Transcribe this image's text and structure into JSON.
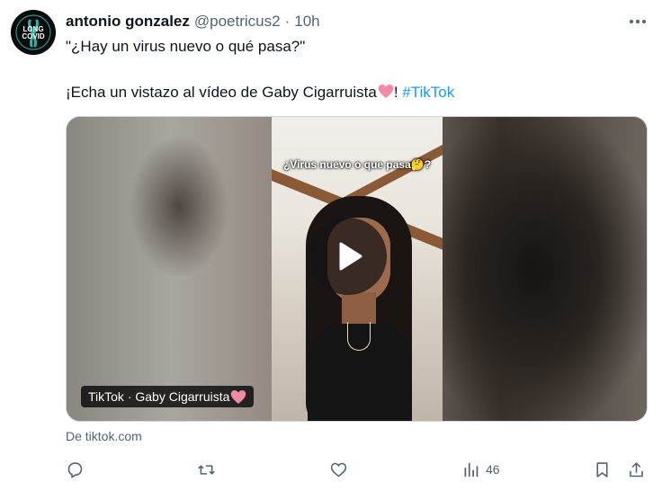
{
  "author": {
    "avatar_text_top": "LONG",
    "avatar_text_bottom": "COVID",
    "display_name": "antonio gonzalez",
    "handle": "@poetricus2",
    "separator": "·",
    "time": "10h"
  },
  "tweet": {
    "line1": "\"¿Hay un virus nuevo o qué pasa?\"",
    "line2_text": "¡Echa un vistazo al vídeo de Gaby Cigarruista",
    "line2_after_emoji": "! ",
    "hashtag": "#TikTok"
  },
  "card": {
    "video_caption": "¿Virus nuevo o que pasa🤔?",
    "source_label": "TikTok · Gaby Cigarruista",
    "domain": "De tiktok.com"
  },
  "actions": {
    "views_count": "46"
  },
  "colors": {
    "accent": "#1d9bf0",
    "secondary_text": "#536471",
    "heart": "#f08aa6"
  },
  "icons": [
    "more-icon",
    "play-icon",
    "heart-emoji-icon",
    "reply-icon",
    "repost-icon",
    "like-icon",
    "views-icon",
    "bookmark-icon",
    "share-icon"
  ]
}
